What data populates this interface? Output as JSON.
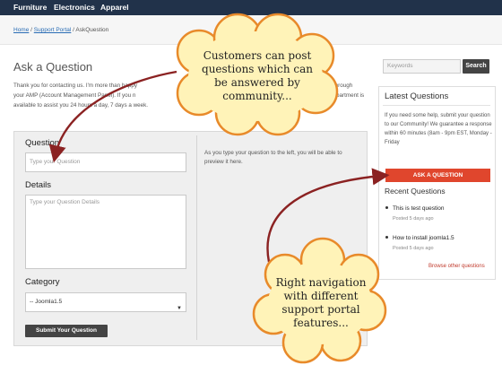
{
  "nav": {
    "items": [
      "Furniture",
      "Electronics",
      "Apparel"
    ]
  },
  "breadcrumb": {
    "home": "Home",
    "sep": " / ",
    "support": "Support Portal",
    "current": "AskQuestion"
  },
  "page": {
    "title": "Ask a Question",
    "intro_l1": "Thank you for contacting us. I'm more than happy",
    "intro_l1b": "der through",
    "intro_l2": "your AMP (Account Management Panel). If you n",
    "intro_l2b": "partment is",
    "intro_l3": "available to assist you 24 hours a day, 7 days a week."
  },
  "form": {
    "question_label": "Question",
    "question_placeholder": "Type your Question",
    "details_label": "Details",
    "details_placeholder": "Type your Question Details",
    "category_label": "Category",
    "category_value": "-- Joomla1.5",
    "submit_label": "Submit Your Question",
    "hint": "As you type your question to the left, you will be able to preview it here."
  },
  "search": {
    "placeholder": "Keywords",
    "button": "Search"
  },
  "sidebar": {
    "latest_title": "Latest Questions",
    "help_text": "If you need some help, submit your question to our Community! We guarantee a response within 60 minutes (8am - 9pm EST, Monday - Friday",
    "ask_button": "ASK A QUESTION",
    "recent_title": "Recent Questions",
    "questions": [
      {
        "title": "This is test question",
        "date": "Posted 5 days ago"
      },
      {
        "title": "How to install joomla1.5",
        "date": "Posted 5 days ago"
      }
    ],
    "browse_link": "Browse other questions"
  },
  "callouts": {
    "top": [
      "Customers can post",
      "questions which can",
      "be answered by",
      "community..."
    ],
    "bottom": [
      "Right navigation",
      "with different",
      "support portal",
      "features..."
    ]
  },
  "colors": {
    "nav_bg": "#21324a",
    "accent": "#e0462d",
    "cloud_fill": "#fff3b8",
    "cloud_stroke": "#e88a2a",
    "arrow": "#8b2222"
  }
}
